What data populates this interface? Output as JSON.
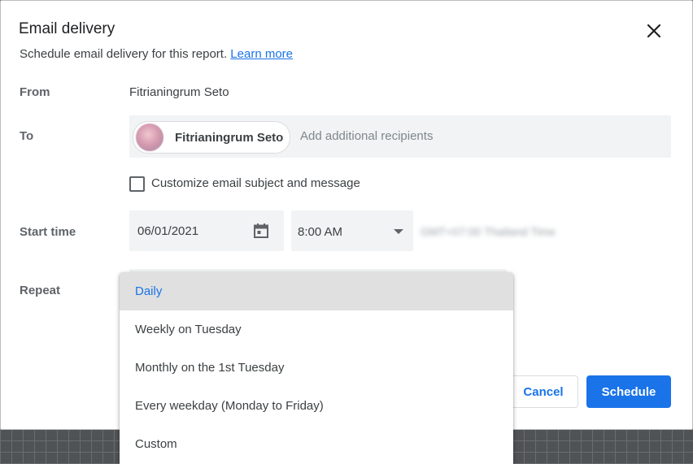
{
  "dialog": {
    "title": "Email delivery",
    "subtitle": "Schedule email delivery for this report.",
    "learn_more": "Learn more"
  },
  "form": {
    "from_label": "From",
    "from_value": "Fitrianingrum Seto",
    "to_label": "To",
    "recipient_name": "Fitrianingrum Seto",
    "to_placeholder": "Add additional recipients",
    "customize_label": "Customize email subject and message",
    "customize_checked": false,
    "start_time_label": "Start time",
    "start_date": "06/01/2021",
    "start_time": "8:00 AM",
    "timezone": "GMT+07:00 Thailand Time",
    "repeat_label": "Repeat"
  },
  "repeat_options": [
    {
      "label": "Daily",
      "selected": true
    },
    {
      "label": "Weekly on Tuesday",
      "selected": false
    },
    {
      "label": "Monthly on the 1st Tuesday",
      "selected": false
    },
    {
      "label": "Every weekday (Monday to Friday)",
      "selected": false
    },
    {
      "label": "Custom",
      "selected": false
    }
  ],
  "buttons": {
    "cancel": "Cancel",
    "schedule": "Schedule"
  },
  "icons": {
    "close": "close-icon",
    "calendar": "calendar-icon",
    "dropdown_arrow": "arrow-drop-down-icon"
  },
  "colors": {
    "accent": "#1a73e8",
    "field_bg": "#f1f3f4",
    "selected_option_bg": "#e0e0e0"
  }
}
